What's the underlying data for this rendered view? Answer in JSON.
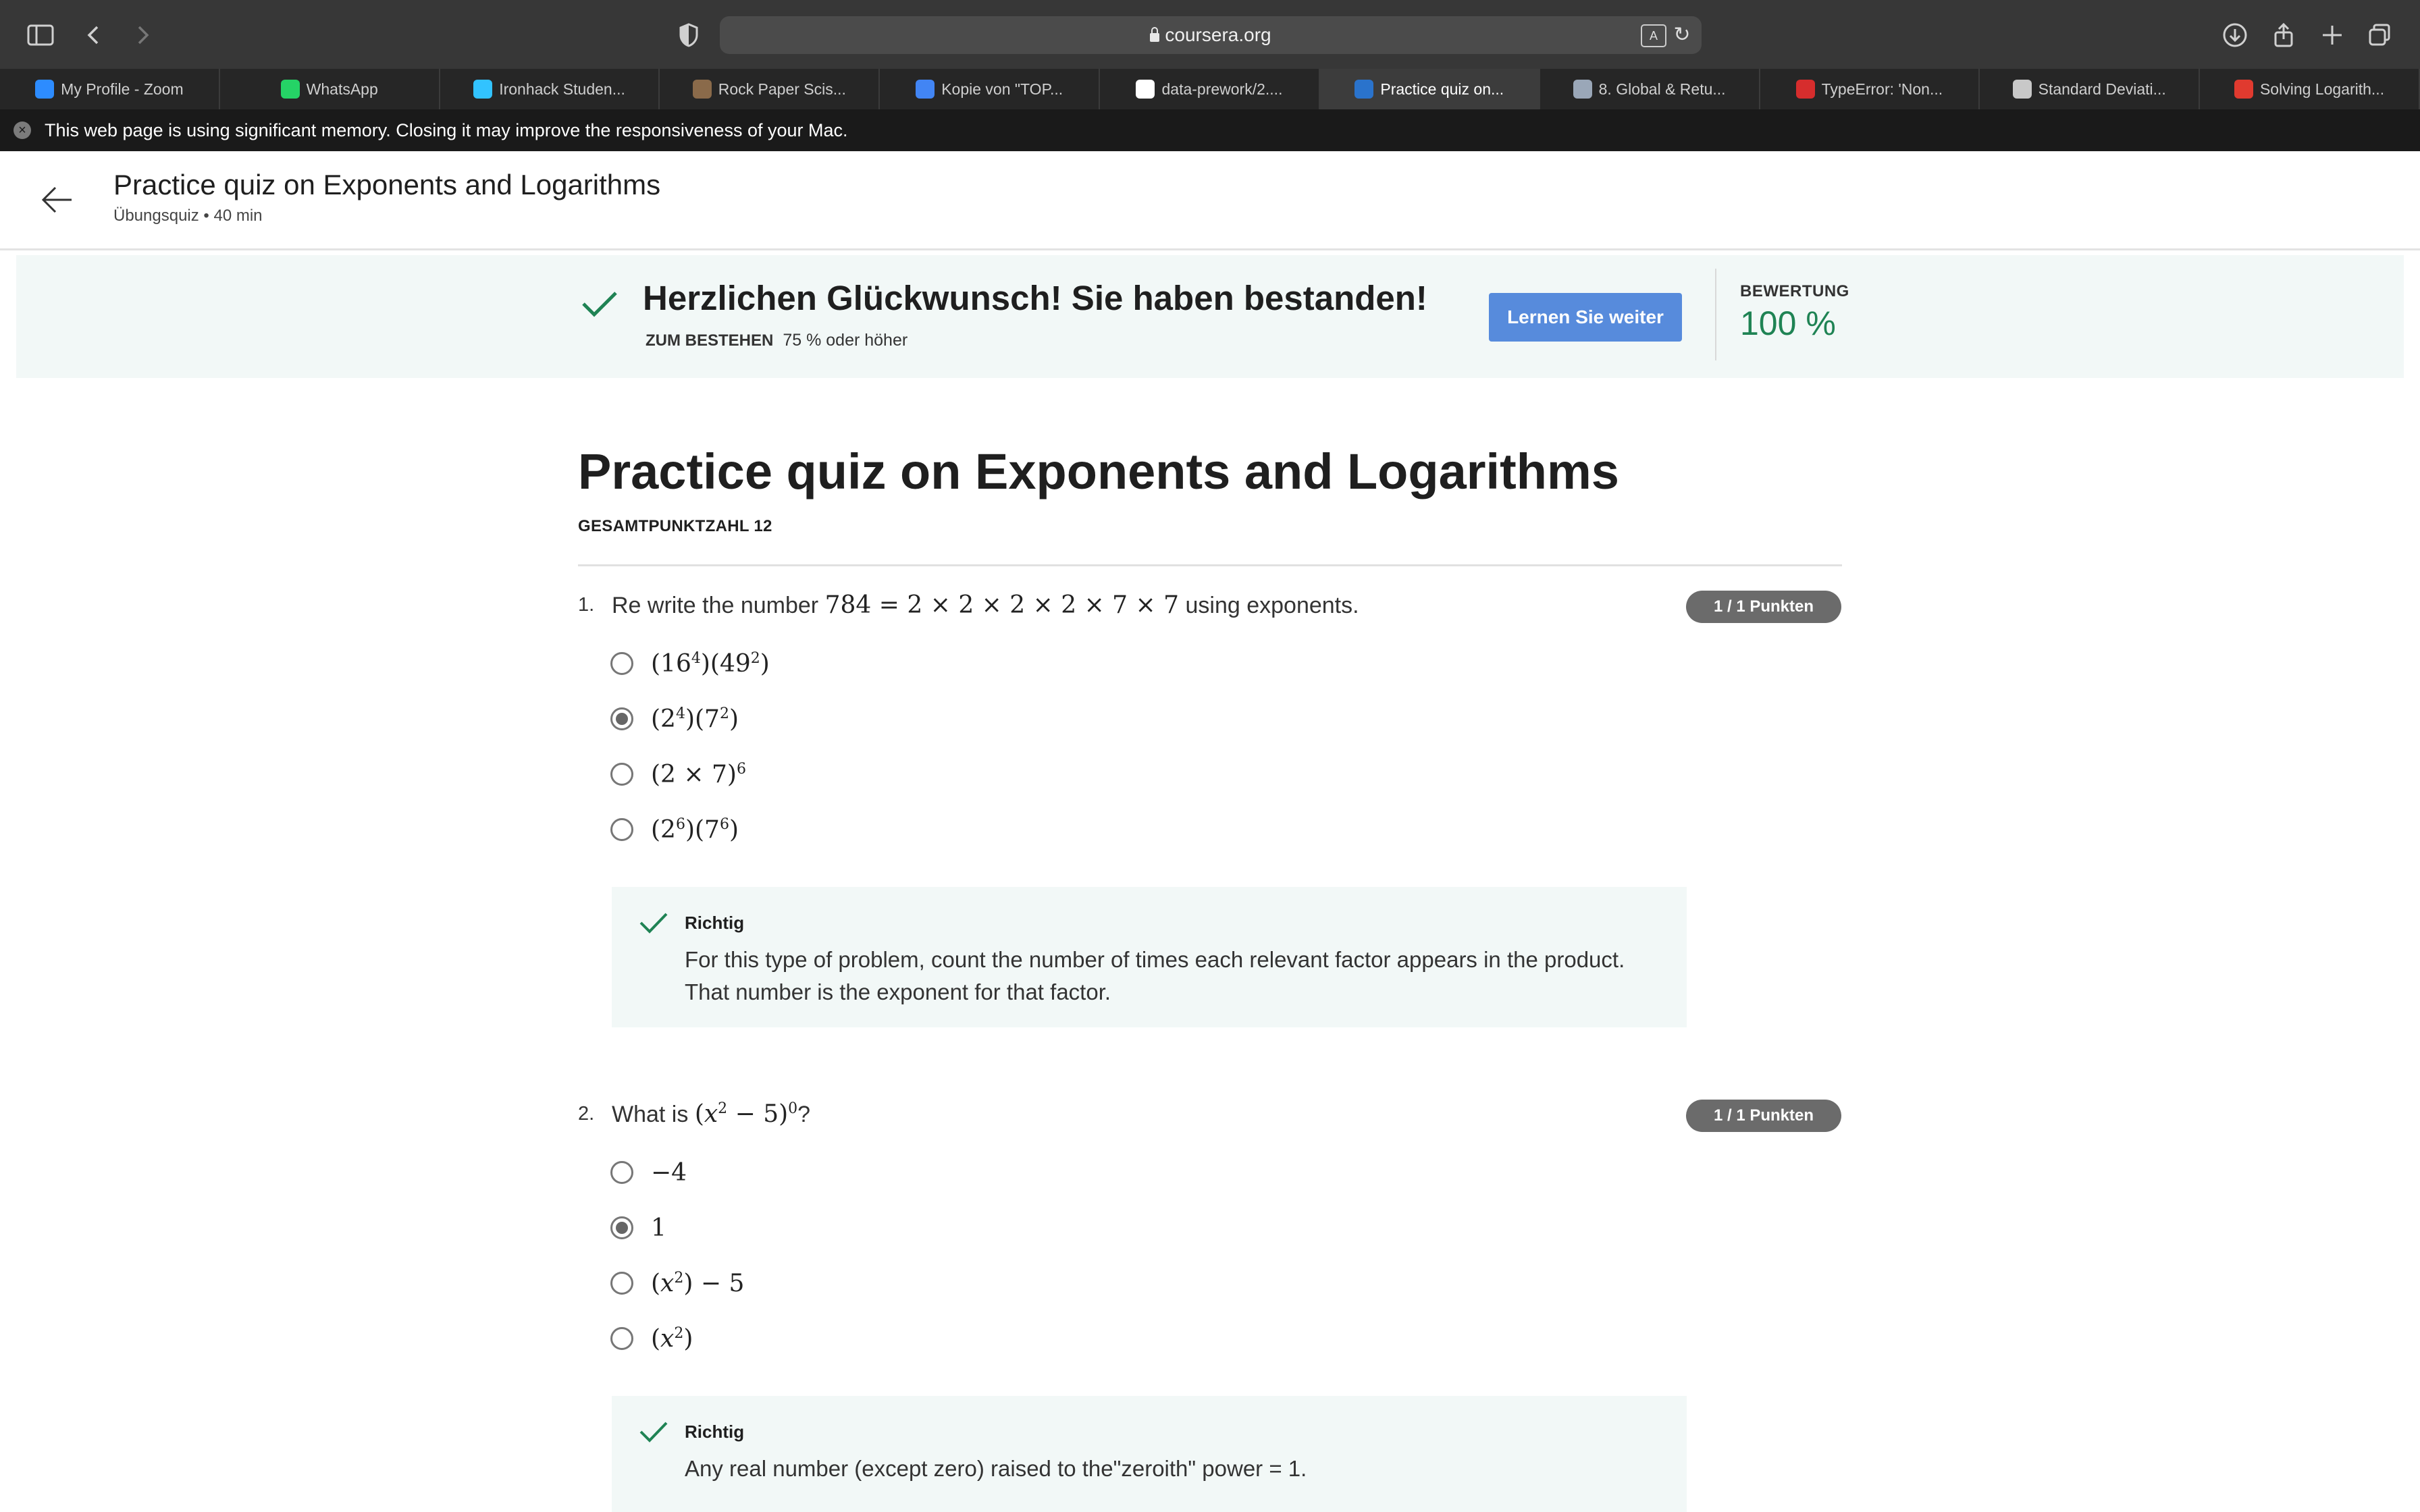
{
  "browser": {
    "url": "coursera.org",
    "tabs": [
      {
        "label": "My Profile - Zoom",
        "icon": "zoom-icon",
        "color": "#2d8cff"
      },
      {
        "label": "WhatsApp",
        "icon": "whatsapp-icon",
        "color": "#25d366"
      },
      {
        "label": "Ironhack Studen...",
        "icon": "ironhack-icon",
        "color": "#32c3ff"
      },
      {
        "label": "Rock Paper Scis...",
        "icon": "rps-icon",
        "color": "#8a6a4a"
      },
      {
        "label": "Kopie von \"TOP...",
        "icon": "docs-icon",
        "color": "#4285f4"
      },
      {
        "label": "data-prework/2....",
        "icon": "github-icon",
        "color": "#ffffff"
      },
      {
        "label": "Practice quiz on...",
        "icon": "coursera-icon",
        "color": "#2a73cc",
        "active": true
      },
      {
        "label": "8. Global & Retu...",
        "icon": "book-icon",
        "color": "#9aa7b8"
      },
      {
        "label": "TypeError: 'Non...",
        "icon": "n-icon",
        "color": "#d62d2d"
      },
      {
        "label": "Standard Deviati...",
        "icon": "chart-icon",
        "color": "#c8c8c8"
      },
      {
        "label": "Solving Logarith...",
        "icon": "c-icon",
        "color": "#e03a2f"
      }
    ],
    "memory_warning": "This web page is using significant memory. Closing it may improve the responsiveness of your Mac."
  },
  "header": {
    "title": "Practice quiz on Exponents and Logarithms",
    "subtitle": "Übungsquiz • 40 min"
  },
  "banner": {
    "title": "Herzlichen Glückwunsch! Sie haben bestanden!",
    "pass_label": "ZUM BESTEHEN",
    "pass_value": "75 % oder höher",
    "continue_label": "Lernen Sie weiter",
    "grade_label": "BEWERTUNG",
    "grade_value": "100 %"
  },
  "quiz": {
    "title": "Practice quiz on Exponents and Logarithms",
    "total_points": "GESAMTPUNKTZAHL 12",
    "questions": [
      {
        "number": "1.",
        "text_before": "Re write the number",
        "text_after": "using exponents.",
        "badge": "1 / 1 Punkten",
        "selected": 1,
        "feedback_label": "Richtig",
        "feedback_text": "For this type of problem, count the number of times each relevant factor appears in the product. That number is the exponent for that factor."
      },
      {
        "number": "2.",
        "text_before": "What is",
        "text_after": "?",
        "badge": "1 / 1 Punkten",
        "selected": 1,
        "feedback_label": "Richtig",
        "feedback_text": "Any real number (except zero) raised to the\"zeroith\" power = 1."
      }
    ]
  }
}
